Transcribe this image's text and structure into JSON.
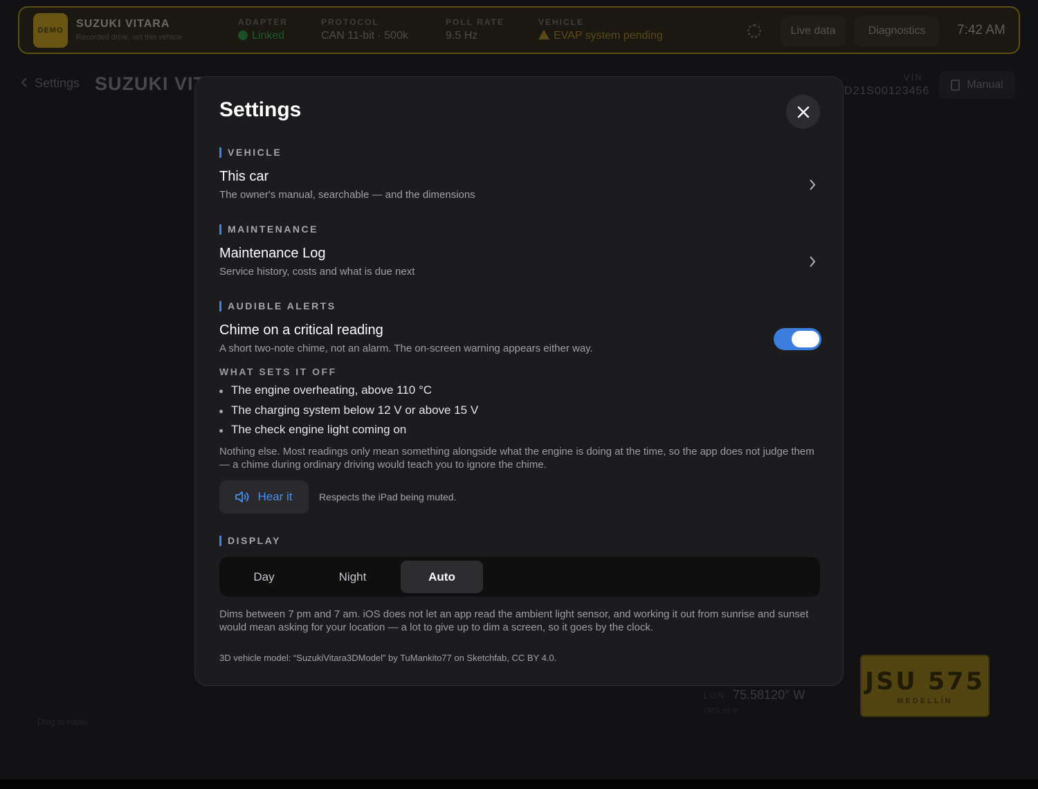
{
  "topbar": {
    "badge": "DEMO",
    "vehicle_name": "SUZUKI VITARA",
    "vehicle_sub": "Recorded drive, not this vehicle",
    "adapter_label": "ADAPTER",
    "adapter_value": "Linked",
    "protocol_label": "PROTOCOL",
    "protocol_value": "CAN 11-bit · 500k",
    "poll_label": "POLL RATE",
    "poll_value": "9.5 Hz",
    "vehicle_label": "VEHICLE",
    "vehicle_value": "EVAP system pending",
    "live_data": "Live data",
    "diagnostics": "Diagnostics",
    "clock": "7:42 AM"
  },
  "page": {
    "back": "Settings",
    "title": "SUZUKI VITARA",
    "vin_label": "VIN",
    "vin_value": "D21S00123456",
    "manual": "Manual",
    "lon_label": "LON",
    "lon_value": "75.58120° W",
    "gps": "GPS ±6 m",
    "drag_hint": "Drag to rotate",
    "plate_number": "JSU 575",
    "plate_city": "MEDELLÍN"
  },
  "modal": {
    "title": "Settings",
    "vehicle_section": "VEHICLE",
    "this_car_title": "This car",
    "this_car_sub": "The owner's manual, searchable — and the dimensions",
    "maintenance_section": "MAINTENANCE",
    "log_title": "Maintenance Log",
    "log_sub": "Service history, costs and what is due next",
    "alerts_section": "AUDIBLE ALERTS",
    "chime_title": "Chime on a critical reading",
    "chime_sub": "A short two-note chime, not an alarm. The on-screen warning appears either way.",
    "chime_enabled": true,
    "triggers_heading": "WHAT SETS IT OFF",
    "triggers": [
      "The engine overheating, above 110 °C",
      "The charging system below 12 V or above 15 V",
      "The check engine light coming on"
    ],
    "triggers_note": "Nothing else. Most readings only mean something alongside what the engine is doing at the time, so the app does not judge them — a chime during ordinary driving would teach you to ignore the chime.",
    "hear_it": "Hear it",
    "hear_note": "Respects the iPad being muted.",
    "display_section": "DISPLAY",
    "display_options": [
      "Day",
      "Night",
      "Auto"
    ],
    "display_selected": "Auto",
    "display_note": "Dims between 7 pm and 7 am. iOS does not let an app read the ambient light sensor, and working it out from sunrise and sunset would mean asking for your location — a lot to give up to dim a screen, so it goes by the clock.",
    "credit": "3D vehicle model: “SuzukiVitara3DModel” by TuMankito77 on Sketchfab, CC BY 4.0."
  },
  "colors": {
    "accent": "#3b82f6",
    "toggle_on": "#3b7ddd",
    "demo_badge": "#6a5614"
  }
}
